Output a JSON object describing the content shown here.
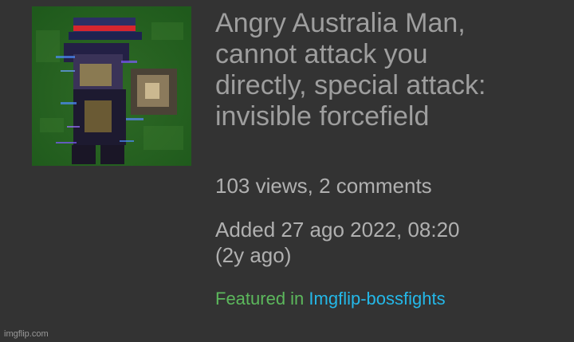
{
  "post": {
    "title_lines": [
      "Angry Australia Man,",
      "cannot attack you",
      "directly, special attack:",
      "invisible forcefield"
    ],
    "stats": "103 views, 2 comments",
    "added_line1": "Added 27 ago 2022, 08:20",
    "added_line2": "(2y ago)",
    "featured_prefix": "Featured in",
    "featured_stream": "Imgflip-bossfights"
  },
  "watermark": "imgflip.com",
  "colors": {
    "background": "#333333",
    "title": "#9e9e9e",
    "meta_text": "#b0b0b0",
    "featured_green": "#5cb85c",
    "link_blue": "#24b8e8"
  }
}
